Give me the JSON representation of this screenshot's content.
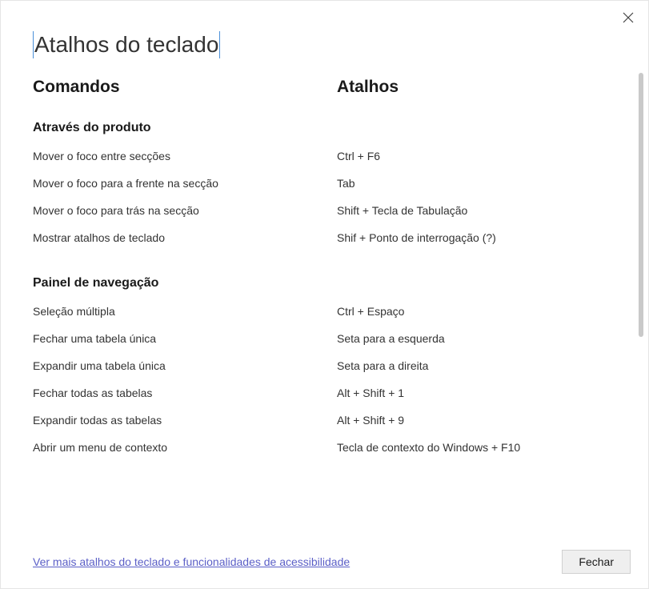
{
  "title": "Atalhos do teclado",
  "columns": {
    "commands": "Comandos",
    "shortcuts": "Atalhos"
  },
  "sections": [
    {
      "title": "Através do produto",
      "rows": [
        {
          "command": "Mover o foco entre secções",
          "shortcut": "Ctrl + F6"
        },
        {
          "command": "Mover o foco para a frente na secção",
          "shortcut": "Tab"
        },
        {
          "command": "Mover o foco para trás na secção",
          "shortcut": "Shift + Tecla de Tabulação"
        },
        {
          "command": "Mostrar atalhos de teclado",
          "shortcut": "Shif + Ponto de interrogação (?)"
        }
      ]
    },
    {
      "title": "Painel de navegação",
      "rows": [
        {
          "command": "Seleção múltipla",
          "shortcut": "Ctrl + Espaço"
        },
        {
          "command": "Fechar uma tabela única",
          "shortcut": "Seta para a esquerda"
        },
        {
          "command": "Expandir uma tabela única",
          "shortcut": "Seta para a direita"
        },
        {
          "command": "Fechar todas as tabelas",
          "shortcut": "Alt + Shift + 1"
        },
        {
          "command": "Expandir todas as tabelas",
          "shortcut": "Alt + Shift + 9"
        },
        {
          "command": "Abrir um menu de contexto",
          "shortcut": "Tecla de contexto do Windows + F10"
        }
      ]
    }
  ],
  "footer": {
    "link": "Ver mais atalhos do teclado e funcionalidades de acessibilidade",
    "close": "Fechar"
  }
}
